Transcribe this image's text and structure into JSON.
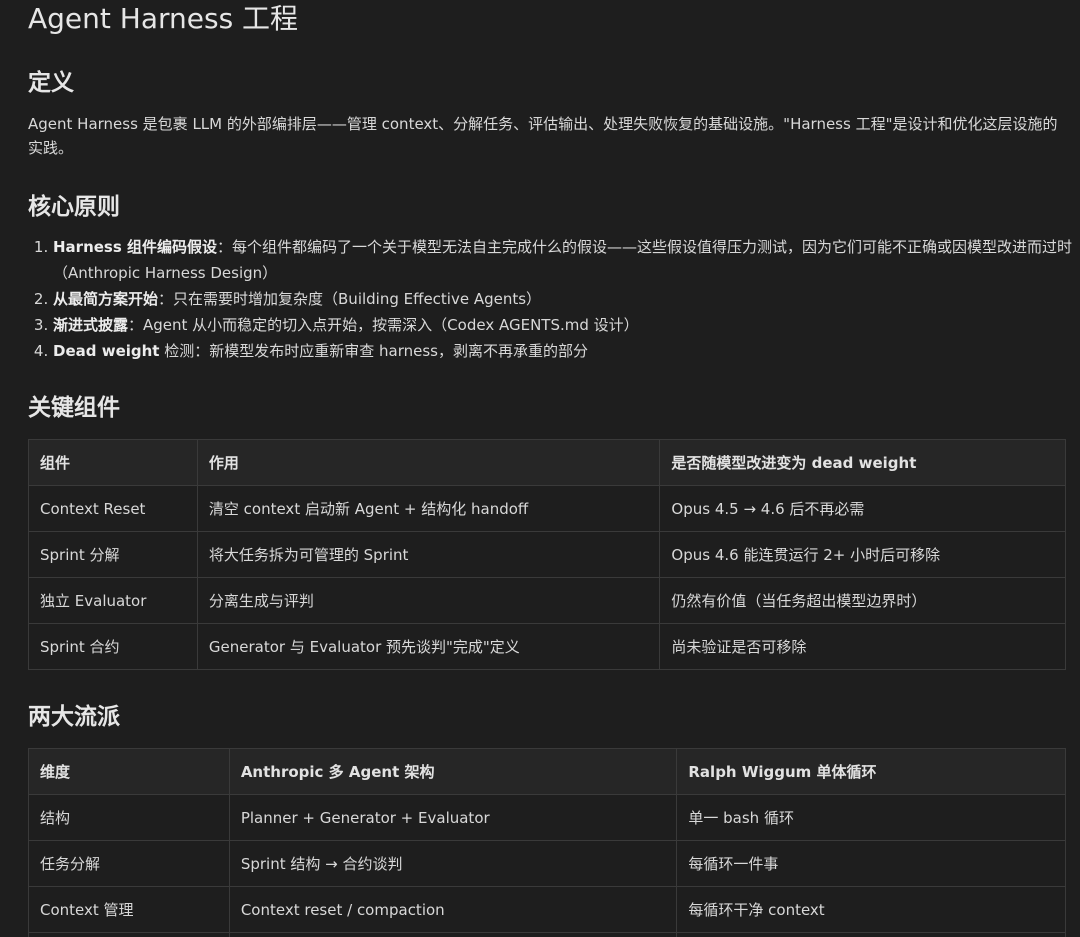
{
  "title": "Agent Harness 工程",
  "definition": {
    "heading": "定义",
    "text": "Agent Harness 是包裹 LLM 的外部编排层——管理 context、分解任务、评估输出、处理失败恢复的基础设施。\"Harness 工程\"是设计和优化这层设施的实践。"
  },
  "principles": {
    "heading": "核心原则",
    "items": [
      {
        "bold": "Harness 组件编码假设",
        "text": "：每个组件都编码了一个关于模型无法自主完成什么的假设——这些假设值得压力测试，因为它们可能不正确或因模型改进而过时（Anthropic Harness Design）"
      },
      {
        "bold": "从最简方案开始",
        "text": "：只在需要时增加复杂度（Building Effective Agents）"
      },
      {
        "bold": "渐进式披露",
        "text": "：Agent 从小而稳定的切入点开始，按需深入（Codex AGENTS.md 设计）"
      },
      {
        "bold": "Dead weight",
        "text": " 检测：新模型发布时应重新审查 harness，剥离不再承重的部分"
      }
    ]
  },
  "components": {
    "heading": "关键组件",
    "headers": [
      "组件",
      "作用",
      "是否随模型改进变为 dead weight"
    ],
    "rows": [
      [
        "Context Reset",
        "清空 context 启动新 Agent + 结构化 handoff",
        "Opus 4.5 → 4.6 后不再必需"
      ],
      [
        "Sprint 分解",
        "将大任务拆为可管理的 Sprint",
        "Opus 4.6 能连贯运行 2+ 小时后可移除"
      ],
      [
        "独立 Evaluator",
        "分离生成与评判",
        "仍然有价值（当任务超出模型边界时）"
      ],
      [
        "Sprint 合约",
        "Generator 与 Evaluator 预先谈判\"完成\"定义",
        "尚未验证是否可移除"
      ]
    ]
  },
  "schools": {
    "heading": "两大流派",
    "headers": [
      "维度",
      "Anthropic 多 Agent 架构",
      "Ralph Wiggum 单体循环"
    ],
    "rows": [
      [
        "结构",
        "Planner + Generator + Evaluator",
        "单一 bash 循环"
      ],
      [
        "任务分解",
        "Sprint 结构 → 合约谈判",
        "每循环一件事"
      ],
      [
        "Context 管理",
        "Context reset / compaction",
        "每循环干净 context"
      ]
    ]
  }
}
